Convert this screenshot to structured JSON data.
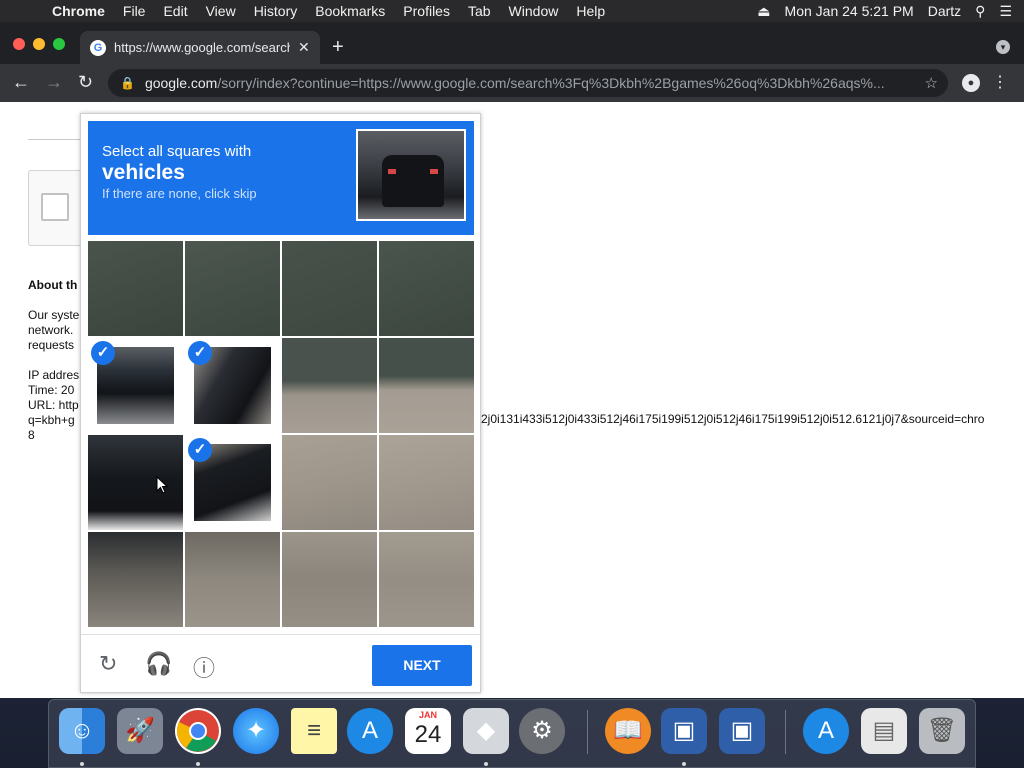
{
  "menubar": {
    "app": "Chrome",
    "items": [
      "File",
      "Edit",
      "View",
      "History",
      "Bookmarks",
      "Profiles",
      "Tab",
      "Window",
      "Help"
    ],
    "datetime": "Mon Jan 24  5:21 PM",
    "user": "Dartz"
  },
  "browser": {
    "tab_title": "https://www.google.com/search",
    "url_host": "google.com",
    "url_path": "/sorry/index?continue=https://www.google.com/search%3Fq%3Dkbh%2Bgames%26oq%3Dkbh%26aqs%..."
  },
  "page": {
    "about_heading": "About th",
    "lines": [
      "Our syste",
      "network.",
      "requests",
      "IP addres",
      "Time: 20",
      "URL: http",
      "q=kbh+g",
      "8"
    ],
    "url_tail": "2j0i131i433i512j0i433i512j46i175i199i512j0i512j46i175i199i512j0i512.6121j0j7&sourceid=chro"
  },
  "captcha": {
    "instruction": "Select all squares with",
    "target": "vehicles",
    "hint": "If there are none, click skip",
    "next_label": "NEXT",
    "selected_tiles": [
      4,
      5,
      9
    ],
    "check_glyph": "✓"
  },
  "icons": {
    "reload": "refresh-icon",
    "audio": "headphones-icon",
    "info": "info-icon"
  },
  "dock": {
    "calendar_month": "JAN",
    "calendar_day": "24"
  },
  "colors": {
    "accent": "#1a73e8"
  }
}
